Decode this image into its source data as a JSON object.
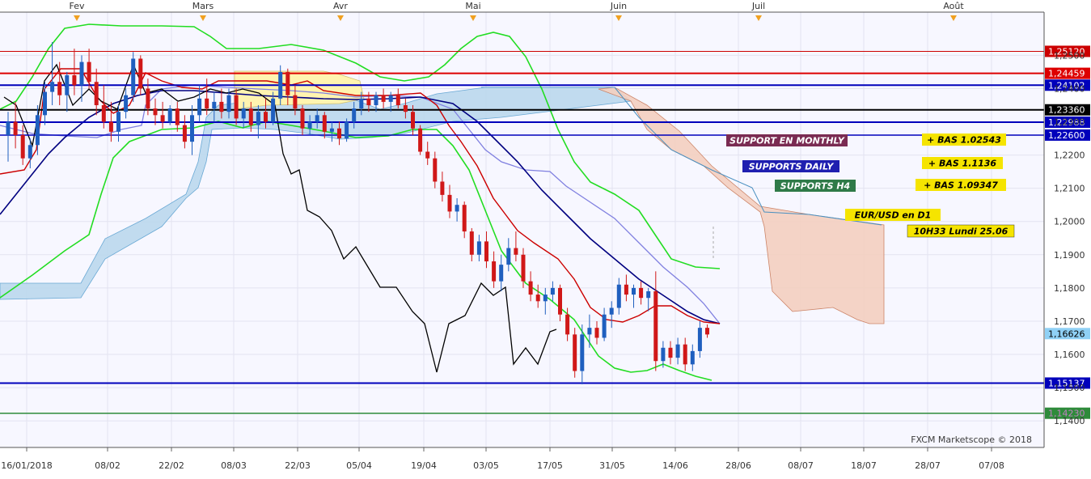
{
  "app": {
    "watermark": "FXCM Marketscope © 2018"
  },
  "colors": {
    "background": "#f7f7ff",
    "grid": "#e3e3f0",
    "candle_up": "#1f5fbf",
    "candle_down": "#d01818",
    "price_line": "#000000",
    "tenkan": "#cc0000",
    "kijun": "#000080",
    "chikou": "#000000",
    "bollinger": "#22dd22",
    "ma_light": "#8080e0",
    "cloud_bull": "#bcd9ee",
    "cloud_bear": "#f4d0c0",
    "cloud_yellow": "#fff4b0"
  },
  "chart_data": {
    "type": "candlestick",
    "title": "EUR/USD  en D1",
    "timestamp_label": "10H33 Lundi 25.06",
    "ylim": [
      1.132,
      1.263
    ],
    "y_ticks": [
      1.14,
      1.15,
      1.16,
      1.17,
      1.18,
      1.19,
      1.2,
      1.21,
      1.22,
      1.23,
      1.24,
      1.25
    ],
    "y_tick_labels": [
      "1,1400",
      "1,1500",
      "1,1600",
      "1,1700",
      "1,1800",
      "1,1900",
      "1,2000",
      "1,2100",
      "1,2200",
      "1,2300",
      "1,2400",
      "1,2500"
    ],
    "month_labels": [
      "Fev",
      "Mars",
      "Avr",
      "Mai",
      "Juin",
      "Juil",
      "Août"
    ],
    "x_dates": [
      "16/01/2018",
      "08/02",
      "22/02",
      "08/03",
      "22/03",
      "05/04",
      "19/04",
      "03/05",
      "17/05",
      "31/05",
      "14/06",
      "28/06",
      "08/07",
      "18/07",
      "28/07",
      "07/08"
    ],
    "levels": [
      {
        "label": "1,25120",
        "value": 1.2512,
        "color": "#cc0000",
        "style": "thin"
      },
      {
        "label": "1,24459",
        "value": 1.24459,
        "color": "#dd0000",
        "style": "thick"
      },
      {
        "label": "1,24102",
        "value": 1.24102,
        "color": "#0000bb",
        "style": "thick"
      },
      {
        "label": "1,23360",
        "value": 1.2336,
        "color": "#000000",
        "style": "thick"
      },
      {
        "label": "1,22988",
        "value": 1.22988,
        "color": "#0000bb",
        "style": "thick"
      },
      {
        "label": "1,22600",
        "value": 1.226,
        "color": "#0000bb",
        "style": "medium"
      },
      {
        "label": "1,16626",
        "value": 1.16626,
        "color": "#8fd0f5",
        "style": "price"
      },
      {
        "label": "1,15137",
        "value": 1.15137,
        "color": "#0000bb",
        "style": "thick"
      },
      {
        "label": "1,14230",
        "value": 1.1423,
        "color": "#2e8b3a",
        "style": "medium"
      }
    ],
    "annotations": [
      {
        "text": "SUPPORT EN MONTHLY",
        "bg": "#7a2b52",
        "fg": "#ffffff"
      },
      {
        "text": "SUPPORTS DAILY",
        "bg": "#1f1fb0",
        "fg": "#ffffff"
      },
      {
        "text": "SUPPORTS H4",
        "bg": "#2f7a48",
        "fg": "#ffffff"
      },
      {
        "text": "+ BAS 1.02543",
        "bg": "#f5e400",
        "fg": "#000000"
      },
      {
        "text": "+ BAS  1.1136",
        "bg": "#f5e400",
        "fg": "#000000"
      },
      {
        "text": "+ BAS   1.09347",
        "bg": "#f5e400",
        "fg": "#000000"
      }
    ],
    "ohlc": [
      {
        "o": 1.226,
        "h": 1.233,
        "l": 1.218,
        "c": 1.23
      },
      {
        "o": 1.23,
        "h": 1.236,
        "l": 1.222,
        "c": 1.226
      },
      {
        "o": 1.226,
        "h": 1.229,
        "l": 1.217,
        "c": 1.219
      },
      {
        "o": 1.219,
        "h": 1.225,
        "l": 1.216,
        "c": 1.223
      },
      {
        "o": 1.223,
        "h": 1.235,
        "l": 1.22,
        "c": 1.232
      },
      {
        "o": 1.232,
        "h": 1.242,
        "l": 1.229,
        "c": 1.239
      },
      {
        "o": 1.239,
        "h": 1.254,
        "l": 1.235,
        "c": 1.242
      },
      {
        "o": 1.242,
        "h": 1.248,
        "l": 1.235,
        "c": 1.238
      },
      {
        "o": 1.238,
        "h": 1.245,
        "l": 1.233,
        "c": 1.244
      },
      {
        "o": 1.244,
        "h": 1.252,
        "l": 1.238,
        "c": 1.241
      },
      {
        "o": 1.241,
        "h": 1.25,
        "l": 1.236,
        "c": 1.248
      },
      {
        "o": 1.248,
        "h": 1.252,
        "l": 1.24,
        "c": 1.242
      },
      {
        "o": 1.242,
        "h": 1.246,
        "l": 1.232,
        "c": 1.235
      },
      {
        "o": 1.235,
        "h": 1.241,
        "l": 1.228,
        "c": 1.23
      },
      {
        "o": 1.23,
        "h": 1.236,
        "l": 1.224,
        "c": 1.227
      },
      {
        "o": 1.227,
        "h": 1.235,
        "l": 1.224,
        "c": 1.233
      },
      {
        "o": 1.233,
        "h": 1.24,
        "l": 1.231,
        "c": 1.238
      },
      {
        "o": 1.238,
        "h": 1.251,
        "l": 1.236,
        "c": 1.249
      },
      {
        "o": 1.249,
        "h": 1.25,
        "l": 1.238,
        "c": 1.24
      },
      {
        "o": 1.24,
        "h": 1.243,
        "l": 1.232,
        "c": 1.234
      },
      {
        "o": 1.234,
        "h": 1.237,
        "l": 1.229,
        "c": 1.232
      },
      {
        "o": 1.232,
        "h": 1.236,
        "l": 1.228,
        "c": 1.23
      },
      {
        "o": 1.23,
        "h": 1.235,
        "l": 1.229,
        "c": 1.234
      },
      {
        "o": 1.234,
        "h": 1.236,
        "l": 1.227,
        "c": 1.229
      },
      {
        "o": 1.229,
        "h": 1.232,
        "l": 1.222,
        "c": 1.224
      },
      {
        "o": 1.224,
        "h": 1.235,
        "l": 1.22,
        "c": 1.232
      },
      {
        "o": 1.232,
        "h": 1.241,
        "l": 1.23,
        "c": 1.237
      },
      {
        "o": 1.237,
        "h": 1.243,
        "l": 1.232,
        "c": 1.234
      },
      {
        "o": 1.234,
        "h": 1.239,
        "l": 1.23,
        "c": 1.236
      },
      {
        "o": 1.236,
        "h": 1.24,
        "l": 1.231,
        "c": 1.233
      },
      {
        "o": 1.233,
        "h": 1.24,
        "l": 1.231,
        "c": 1.238
      },
      {
        "o": 1.238,
        "h": 1.24,
        "l": 1.229,
        "c": 1.231
      },
      {
        "o": 1.231,
        "h": 1.236,
        "l": 1.228,
        "c": 1.234
      },
      {
        "o": 1.234,
        "h": 1.236,
        "l": 1.227,
        "c": 1.229
      },
      {
        "o": 1.229,
        "h": 1.235,
        "l": 1.225,
        "c": 1.233
      },
      {
        "o": 1.233,
        "h": 1.237,
        "l": 1.228,
        "c": 1.23
      },
      {
        "o": 1.23,
        "h": 1.239,
        "l": 1.229,
        "c": 1.237
      },
      {
        "o": 1.237,
        "h": 1.247,
        "l": 1.235,
        "c": 1.245
      },
      {
        "o": 1.245,
        "h": 1.246,
        "l": 1.235,
        "c": 1.238
      },
      {
        "o": 1.238,
        "h": 1.241,
        "l": 1.232,
        "c": 1.234
      },
      {
        "o": 1.234,
        "h": 1.235,
        "l": 1.226,
        "c": 1.228
      },
      {
        "o": 1.228,
        "h": 1.232,
        "l": 1.226,
        "c": 1.23
      },
      {
        "o": 1.23,
        "h": 1.234,
        "l": 1.228,
        "c": 1.232
      },
      {
        "o": 1.232,
        "h": 1.233,
        "l": 1.225,
        "c": 1.227
      },
      {
        "o": 1.227,
        "h": 1.23,
        "l": 1.224,
        "c": 1.228
      },
      {
        "o": 1.228,
        "h": 1.23,
        "l": 1.223,
        "c": 1.225
      },
      {
        "o": 1.225,
        "h": 1.231,
        "l": 1.224,
        "c": 1.23
      },
      {
        "o": 1.23,
        "h": 1.236,
        "l": 1.228,
        "c": 1.234
      },
      {
        "o": 1.234,
        "h": 1.239,
        "l": 1.232,
        "c": 1.237
      },
      {
        "o": 1.237,
        "h": 1.239,
        "l": 1.233,
        "c": 1.235
      },
      {
        "o": 1.235,
        "h": 1.239,
        "l": 1.233,
        "c": 1.238
      },
      {
        "o": 1.238,
        "h": 1.24,
        "l": 1.234,
        "c": 1.236
      },
      {
        "o": 1.236,
        "h": 1.239,
        "l": 1.233,
        "c": 1.238
      },
      {
        "o": 1.238,
        "h": 1.24,
        "l": 1.234,
        "c": 1.235
      },
      {
        "o": 1.235,
        "h": 1.237,
        "l": 1.231,
        "c": 1.233
      },
      {
        "o": 1.233,
        "h": 1.235,
        "l": 1.226,
        "c": 1.228
      },
      {
        "o": 1.228,
        "h": 1.229,
        "l": 1.22,
        "c": 1.221
      },
      {
        "o": 1.221,
        "h": 1.224,
        "l": 1.217,
        "c": 1.219
      },
      {
        "o": 1.219,
        "h": 1.221,
        "l": 1.21,
        "c": 1.212
      },
      {
        "o": 1.212,
        "h": 1.215,
        "l": 1.206,
        "c": 1.208
      },
      {
        "o": 1.208,
        "h": 1.211,
        "l": 1.201,
        "c": 1.203
      },
      {
        "o": 1.203,
        "h": 1.207,
        "l": 1.2,
        "c": 1.205
      },
      {
        "o": 1.205,
        "h": 1.206,
        "l": 1.195,
        "c": 1.197
      },
      {
        "o": 1.197,
        "h": 1.198,
        "l": 1.188,
        "c": 1.19
      },
      {
        "o": 1.19,
        "h": 1.196,
        "l": 1.188,
        "c": 1.194
      },
      {
        "o": 1.194,
        "h": 1.197,
        "l": 1.186,
        "c": 1.188
      },
      {
        "o": 1.188,
        "h": 1.191,
        "l": 1.18,
        "c": 1.182
      },
      {
        "o": 1.182,
        "h": 1.19,
        "l": 1.179,
        "c": 1.187
      },
      {
        "o": 1.187,
        "h": 1.195,
        "l": 1.185,
        "c": 1.192
      },
      {
        "o": 1.192,
        "h": 1.197,
        "l": 1.188,
        "c": 1.19
      },
      {
        "o": 1.19,
        "h": 1.192,
        "l": 1.18,
        "c": 1.182
      },
      {
        "o": 1.182,
        "h": 1.185,
        "l": 1.176,
        "c": 1.178
      },
      {
        "o": 1.178,
        "h": 1.181,
        "l": 1.174,
        "c": 1.176
      },
      {
        "o": 1.176,
        "h": 1.18,
        "l": 1.172,
        "c": 1.178
      },
      {
        "o": 1.178,
        "h": 1.182,
        "l": 1.176,
        "c": 1.18
      },
      {
        "o": 1.18,
        "h": 1.181,
        "l": 1.17,
        "c": 1.172
      },
      {
        "o": 1.172,
        "h": 1.174,
        "l": 1.164,
        "c": 1.166
      },
      {
        "o": 1.166,
        "h": 1.168,
        "l": 1.153,
        "c": 1.155
      },
      {
        "o": 1.155,
        "h": 1.169,
        "l": 1.151,
        "c": 1.166
      },
      {
        "o": 1.166,
        "h": 1.172,
        "l": 1.162,
        "c": 1.168
      },
      {
        "o": 1.168,
        "h": 1.17,
        "l": 1.163,
        "c": 1.165
      },
      {
        "o": 1.165,
        "h": 1.174,
        "l": 1.164,
        "c": 1.172
      },
      {
        "o": 1.172,
        "h": 1.176,
        "l": 1.168,
        "c": 1.174
      },
      {
        "o": 1.174,
        "h": 1.183,
        "l": 1.172,
        "c": 1.181
      },
      {
        "o": 1.181,
        "h": 1.184,
        "l": 1.176,
        "c": 1.178
      },
      {
        "o": 1.178,
        "h": 1.181,
        "l": 1.174,
        "c": 1.18
      },
      {
        "o": 1.18,
        "h": 1.182,
        "l": 1.175,
        "c": 1.177
      },
      {
        "o": 1.177,
        "h": 1.18,
        "l": 1.173,
        "c": 1.179
      },
      {
        "o": 1.179,
        "h": 1.185,
        "l": 1.155,
        "c": 1.158
      },
      {
        "o": 1.158,
        "h": 1.164,
        "l": 1.156,
        "c": 1.162
      },
      {
        "o": 1.162,
        "h": 1.164,
        "l": 1.157,
        "c": 1.159
      },
      {
        "o": 1.159,
        "h": 1.165,
        "l": 1.157,
        "c": 1.163
      },
      {
        "o": 1.163,
        "h": 1.165,
        "l": 1.155,
        "c": 1.157
      },
      {
        "o": 1.157,
        "h": 1.163,
        "l": 1.155,
        "c": 1.161
      },
      {
        "o": 1.161,
        "h": 1.17,
        "l": 1.159,
        "c": 1.168
      },
      {
        "o": 1.168,
        "h": 1.169,
        "l": 1.165,
        "c": 1.166
      }
    ]
  }
}
